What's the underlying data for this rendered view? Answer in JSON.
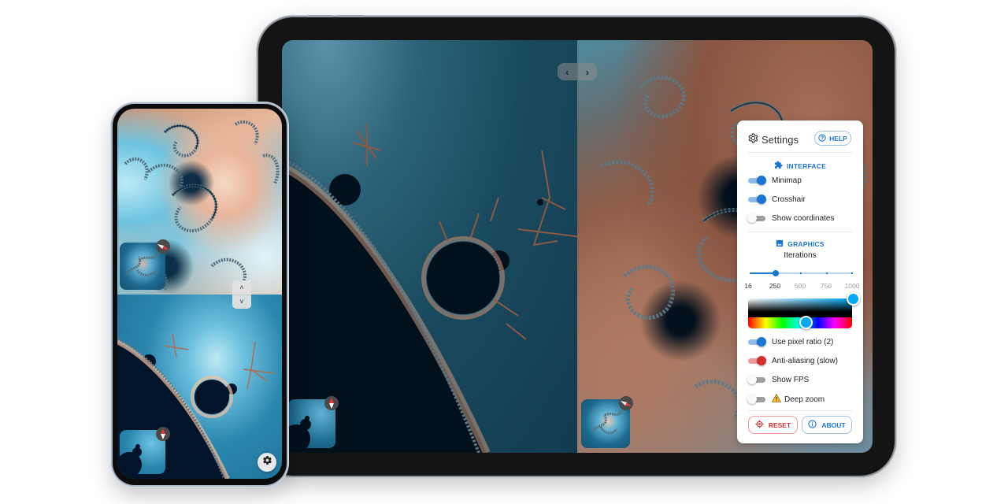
{
  "tablet": {
    "nav": {
      "prev_icon": "‹",
      "next_icon": "›"
    },
    "settings": {
      "title": "Settings",
      "help_label": "HELP",
      "interface_section": "INTERFACE",
      "interface_toggles": [
        {
          "label": "Minimap",
          "on": true,
          "color": "#1976d2"
        },
        {
          "label": "Crosshair",
          "on": true,
          "color": "#1976d2"
        },
        {
          "label": "Show coordinates",
          "on": false,
          "color": "#9e9e9e"
        }
      ],
      "graphics_section": "GRAPHICS",
      "iterations_label": "Iterations",
      "iterations": {
        "value": 250,
        "min": 16,
        "max": 1000,
        "marks": [
          "16",
          "250",
          "500",
          "750",
          "1000"
        ]
      },
      "color_picker": {
        "selected_color": "#03a9f4",
        "hue_position_fraction": 0.55
      },
      "graphics_toggles": [
        {
          "label": "Use pixel ratio (2)",
          "on": true,
          "color": "#1976d2"
        },
        {
          "label": "Anti-aliasing (slow)",
          "on": true,
          "color": "#d32f2f"
        },
        {
          "label": "Show FPS",
          "on": false,
          "color": "#9e9e9e"
        },
        {
          "label": "Deep zoom",
          "on": false,
          "color": "#9e9e9e",
          "warning": true
        }
      ],
      "reset_label": "RESET",
      "about_label": "ABOUT"
    }
  },
  "phone": {
    "nav": {
      "up_icon": "˄",
      "down_icon": "˅"
    },
    "settings_fab": "settings"
  },
  "colors": {
    "primary": "#1976d2",
    "danger": "#d32f2f",
    "warning": "#fbc02d"
  }
}
